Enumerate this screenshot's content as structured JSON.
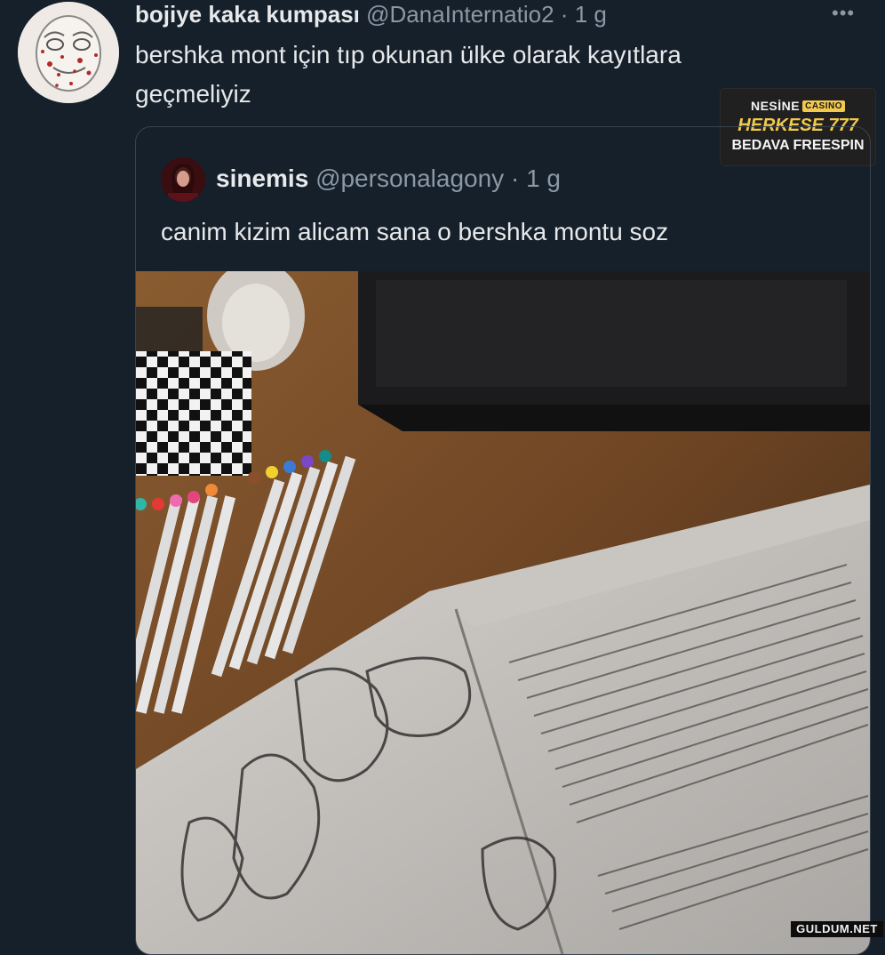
{
  "tweet": {
    "author_name": "bojiye kaka kumpası",
    "handle": "@DanaInternatio2",
    "separator": "·",
    "age": "1 g",
    "more_icon": "more-icon",
    "text": "bershka mont için tıp okunan ülke olarak kayıtlara geçmeliyiz"
  },
  "quote": {
    "author_name": "sinemis",
    "handle": "@personalagony",
    "separator": "·",
    "age": "1 g",
    "text": "canim kizim alicam sana o bershka montu soz"
  },
  "ad": {
    "brand": "NESİNE",
    "brand_tag": "CASINO",
    "line1": "HERKESE 777",
    "line2": "BEDAVA FREESPIN",
    "accent_color": "#f2c94c"
  },
  "watermark": "GULDUM.NET"
}
